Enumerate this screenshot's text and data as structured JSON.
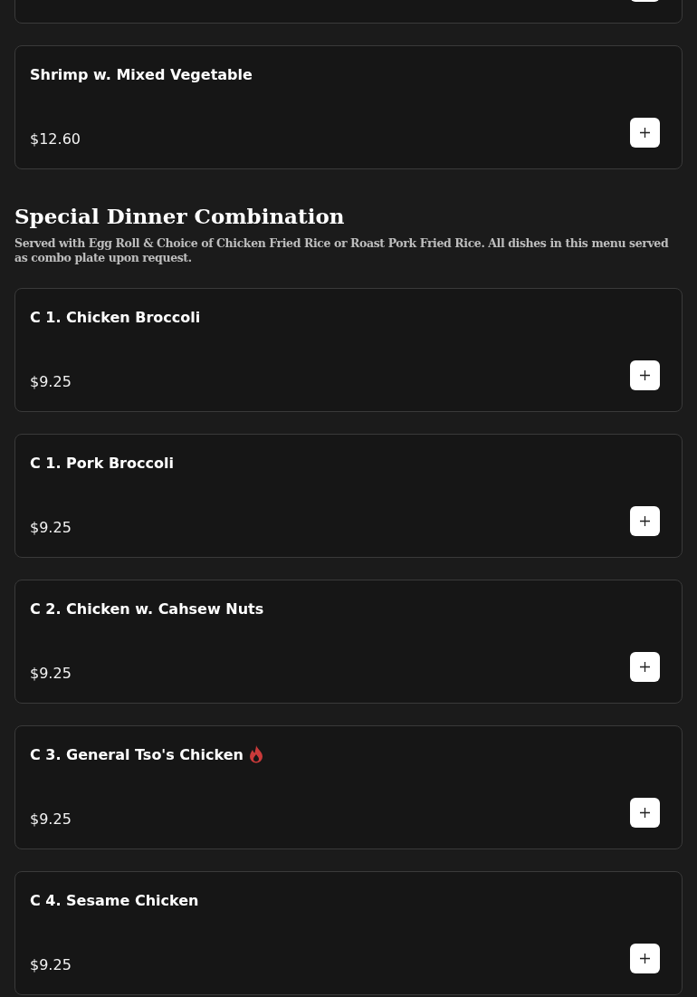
{
  "top_card": {
    "add_button": true
  },
  "items_before": [
    {
      "name": "Shrimp w. Mixed Vegetable",
      "price": "$12.60",
      "spicy": false
    }
  ],
  "section": {
    "title": "Special Dinner Combination",
    "description": "Served with Egg Roll & Choice of Chicken Fried Rice or Roast Pork Fried Rice. All dishes in this menu served as combo plate upon request.",
    "items": [
      {
        "name": "C 1. Chicken Broccoli",
        "price": "$9.25",
        "spicy": false
      },
      {
        "name": "C 1. Pork Broccoli",
        "price": "$9.25",
        "spicy": false
      },
      {
        "name": "C 2. Chicken w. Cahsew Nuts",
        "price": "$9.25",
        "spicy": false
      },
      {
        "name": "C 3. General Tso's Chicken",
        "price": "$9.25",
        "spicy": true
      },
      {
        "name": "C 4. Sesame Chicken",
        "price": "$9.25",
        "spicy": false
      }
    ]
  }
}
